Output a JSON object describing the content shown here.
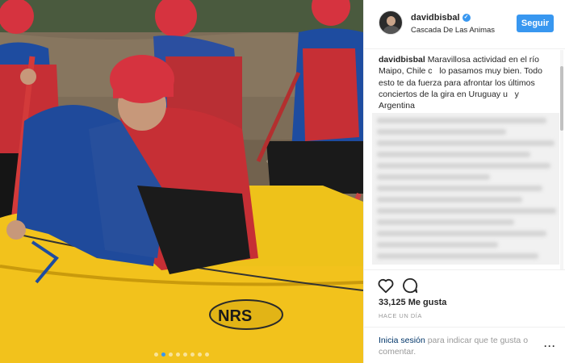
{
  "post": {
    "username": "davidbisbal",
    "location": "Cascada De Las Animas",
    "follow_label": "Seguir",
    "caption_user": "davidbisbal",
    "caption_text": "Maravillosa actividad en el río Maipo, Chile c   lo pasamos muy bien. Todo esto te da fuerza para afrontar los últimos conciertos de la gira en Uruguay u   y Argentina",
    "likes": "33,125 Me gusta",
    "time": "HACE UN DÍA",
    "login_link": "Inicia sesión",
    "login_rest": " para indicar que te gusta o comentar.",
    "more": "···"
  },
  "photo": {
    "raft_logo": "NRS",
    "carousel_count": 8,
    "carousel_active": 1
  },
  "colors": {
    "accent": "#3897f0",
    "raft": "#f2c21c",
    "helmet": "#d6333f",
    "vest": "#c62f35",
    "jacket": "#1e4ca0",
    "water": "#7a6a55"
  },
  "icons": [
    "verified-icon",
    "heart-icon",
    "comment-icon"
  ]
}
